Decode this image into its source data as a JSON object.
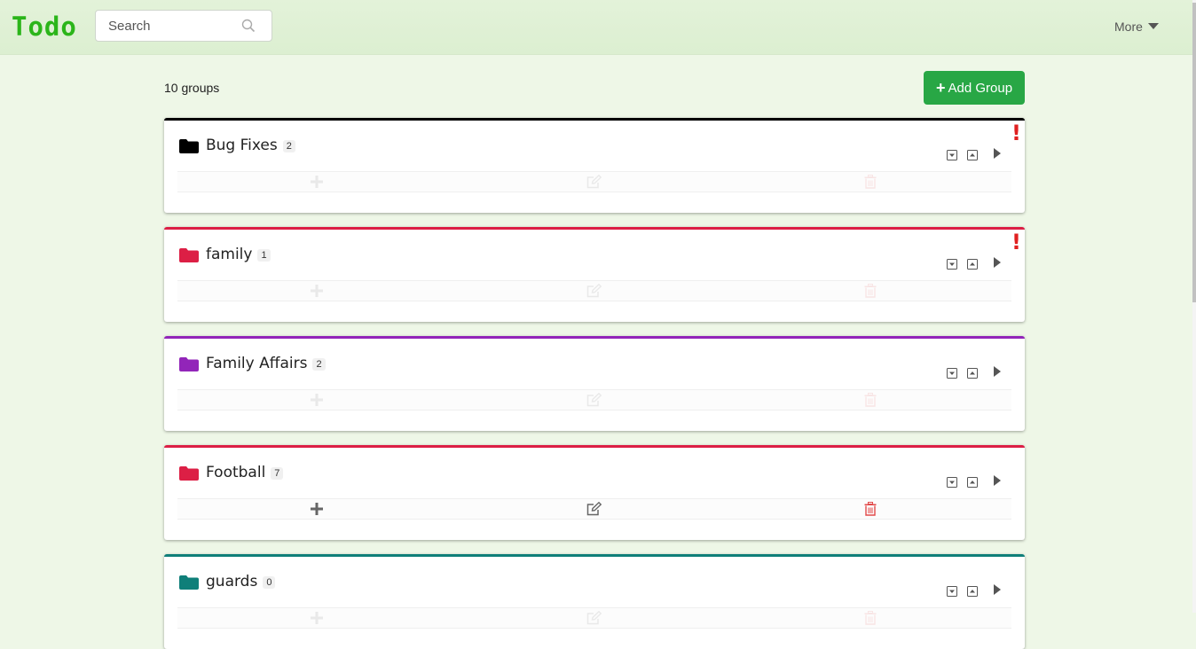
{
  "header": {
    "brand": "Todo",
    "search_placeholder": "Search",
    "more_label": "More"
  },
  "toolbar": {
    "group_count": "10 groups",
    "add_group_label": "Add Group"
  },
  "colors": {
    "brand": "#2bb51a",
    "add_button": "#28a745",
    "alert": "#e02020",
    "delete_icon": "#e24a4a"
  },
  "groups": [
    {
      "name": "Bug Fixes",
      "count": "2",
      "color": "#000000",
      "alert": "!",
      "actions_visible": false
    },
    {
      "name": "family",
      "count": "1",
      "color": "#dc1f45",
      "alert": "!",
      "actions_visible": false
    },
    {
      "name": "Family Affairs",
      "count": "2",
      "color": "#9225b9",
      "alert": "",
      "actions_visible": false
    },
    {
      "name": "Football",
      "count": "7",
      "color": "#dc1f45",
      "alert": "",
      "actions_visible": true
    },
    {
      "name": "guards",
      "count": "0",
      "color": "#0f7f79",
      "alert": "",
      "actions_visible": false
    }
  ]
}
